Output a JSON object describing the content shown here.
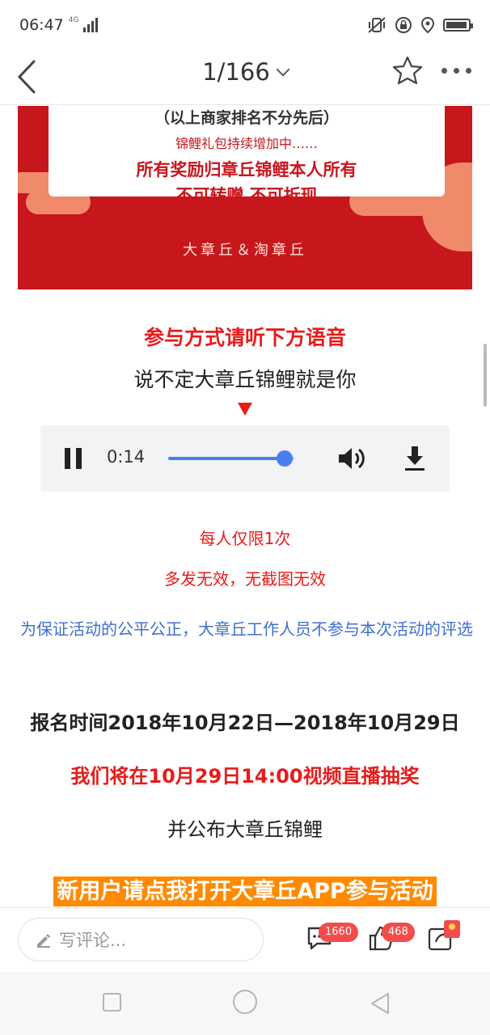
{
  "status_bar": {
    "time": "06:47",
    "network": "4G",
    "icons": [
      "signal-icon",
      "mute-vibrate-icon",
      "lock-rotation-icon",
      "location-icon",
      "battery-icon"
    ],
    "battery_level": 0.95
  },
  "navbar": {
    "page_counter": "1/166",
    "icons": [
      "back-icon",
      "chevron-down-icon",
      "star-icon",
      "more-icon"
    ]
  },
  "banner": {
    "line1": "（以上商家排名不分先后）",
    "line2": "锦鲤礼包持续增加中……",
    "line3": "所有奖励归章丘锦鲤本人所有",
    "line4": "不可转赠  不可折现",
    "brand": "大章丘＆淘章丘",
    "colors": {
      "background": "#c8161d",
      "cloud": "#f08a6a"
    }
  },
  "article": {
    "join_method": "参与方式请听下方语音",
    "tagline": "说不定大章丘锦鲤就是你",
    "audio": {
      "current_time": "0:14",
      "progress": 0.92,
      "icons": [
        "pause-icon",
        "volume-icon",
        "download-icon"
      ]
    },
    "limit_note": "每人仅限1次",
    "invalid_note": "多发无效，无截图无效",
    "fairness_note": "为保证活动的公平公正，大章丘工作人员不参与本次活动的评选",
    "signup_time": "报名时间2018年10月22日—2018年10月29日",
    "draw_notice": "我们将在10月29日14:00视频直播抽奖",
    "announce": "并公布大章丘锦鲤",
    "cta": "新用户请点我打开大章丘APP参与活动"
  },
  "bottom_bar": {
    "comment_placeholder": "写评论...",
    "comment_count": "1660",
    "like_count": "468",
    "icons": [
      "pencil-icon",
      "comment-icon",
      "thumbs-up-icon",
      "share-icon"
    ]
  },
  "colors": {
    "accent_red": "#e81b1b",
    "link_blue": "#3f6fd0",
    "cta_orange": "#ff8a00",
    "player_blue": "#4a7ef0"
  }
}
